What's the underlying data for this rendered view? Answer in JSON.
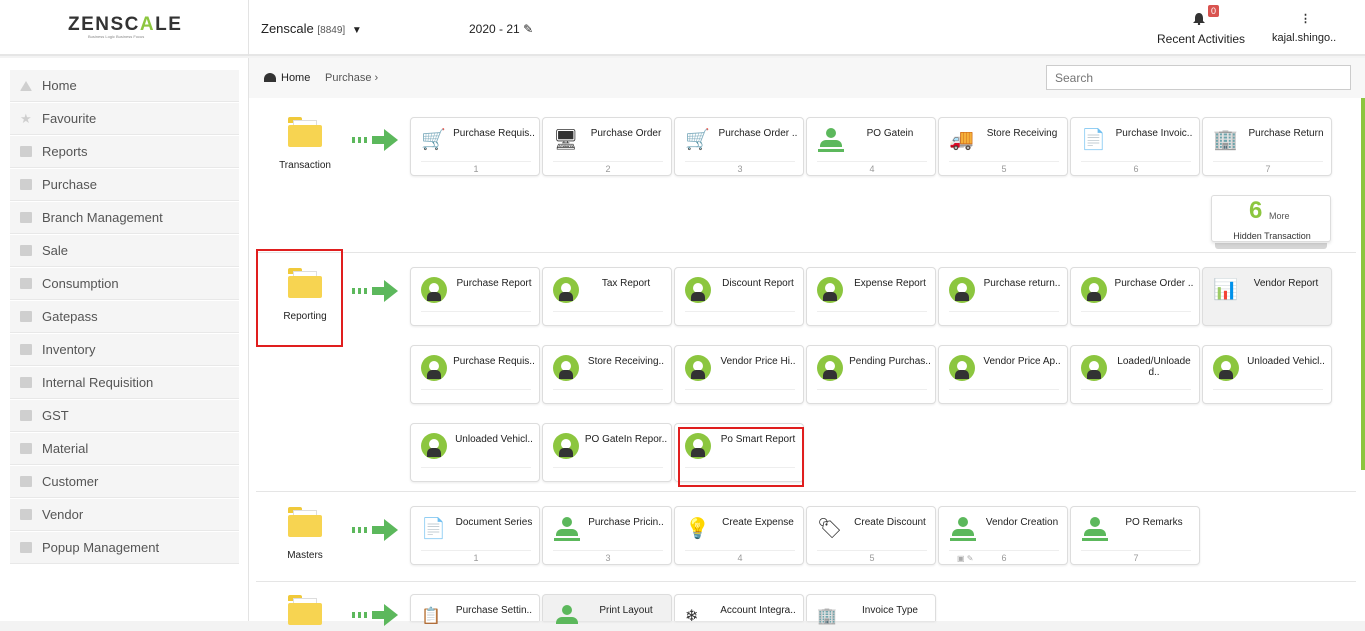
{
  "header": {
    "logo": "ZENSCALE",
    "tagline": "Business Logic Business Focus",
    "company": "Zenscale",
    "company_code": "[8849]",
    "financial_year": "2020 - 21",
    "notification_count": "0",
    "recent_activities": "Recent Activities",
    "user": "kajal.shingo.."
  },
  "sidebar": {
    "items": [
      {
        "label": "Home",
        "icon": "home-icon"
      },
      {
        "label": "Favourite",
        "icon": "star-icon"
      },
      {
        "label": "Reports",
        "icon": "document-icon"
      },
      {
        "label": "Purchase",
        "icon": "folder-icon"
      },
      {
        "label": "Branch Management",
        "icon": "folder-icon"
      },
      {
        "label": "Sale",
        "icon": "folder-icon"
      },
      {
        "label": "Consumption",
        "icon": "folder-icon"
      },
      {
        "label": "Gatepass",
        "icon": "folder-icon"
      },
      {
        "label": "Inventory",
        "icon": "folder-icon"
      },
      {
        "label": "Internal Requisition",
        "icon": "folder-icon"
      },
      {
        "label": "GST",
        "icon": "folder-icon"
      },
      {
        "label": "Material",
        "icon": "folder-icon"
      },
      {
        "label": "Customer",
        "icon": "folder-icon"
      },
      {
        "label": "Vendor",
        "icon": "folder-icon"
      },
      {
        "label": "Popup Management",
        "icon": "folder-icon"
      }
    ]
  },
  "breadcrumb": {
    "home": "Home",
    "current": "Purchase"
  },
  "search": {
    "placeholder": "Search"
  },
  "sections": {
    "transaction": {
      "label": "Transaction",
      "tiles": [
        {
          "label": "Purchase Requis..",
          "num": "1"
        },
        {
          "label": "Purchase Order",
          "num": "2"
        },
        {
          "label": "Purchase Order ..",
          "num": "3"
        },
        {
          "label": "PO Gatein",
          "num": "4"
        },
        {
          "label": "Store Receiving",
          "num": "5"
        },
        {
          "label": "Purchase Invoic..",
          "num": "6"
        },
        {
          "label": "Purchase Return",
          "num": "7"
        }
      ],
      "hidden": {
        "count": "6",
        "more": "More",
        "label": "Hidden Transaction"
      }
    },
    "reporting": {
      "label": "Reporting",
      "tiles": [
        {
          "label": "Purchase Report"
        },
        {
          "label": "Tax Report"
        },
        {
          "label": "Discount Report"
        },
        {
          "label": "Expense Report"
        },
        {
          "label": "Purchase return.."
        },
        {
          "label": "Purchase Order .."
        },
        {
          "label": "Vendor Report"
        },
        {
          "label": "Purchase Requis.."
        },
        {
          "label": "Store Receiving.."
        },
        {
          "label": "Vendor Price Hi.."
        },
        {
          "label": "Pending Purchas.."
        },
        {
          "label": "Vendor Price Ap.."
        },
        {
          "label": "Loaded/Unloade d.."
        },
        {
          "label": "Unloaded Vehicl.."
        },
        {
          "label": "Unloaded Vehicl.."
        },
        {
          "label": "PO GateIn Repor.."
        },
        {
          "label": "Po Smart Report"
        }
      ]
    },
    "masters": {
      "label": "Masters",
      "tiles": [
        {
          "label": "Document Series",
          "num": "1"
        },
        {
          "label": "Purchase Pricin..",
          "num": "3"
        },
        {
          "label": "Create Expense",
          "num": "4"
        },
        {
          "label": "Create Discount",
          "num": "5"
        },
        {
          "label": "Vendor Creation",
          "num": "6"
        },
        {
          "label": "PO Remarks",
          "num": "7"
        }
      ]
    },
    "settings": {
      "tiles": [
        {
          "label": "Purchase Settin.."
        },
        {
          "label": "Print Layout"
        },
        {
          "label": "Account Integra.."
        },
        {
          "label": "Invoice Type"
        }
      ]
    }
  },
  "colors": {
    "accent": "#8cc63f",
    "arrow": "#5cb85c",
    "highlight": "#e01e1e",
    "folder": "#f7d451"
  }
}
